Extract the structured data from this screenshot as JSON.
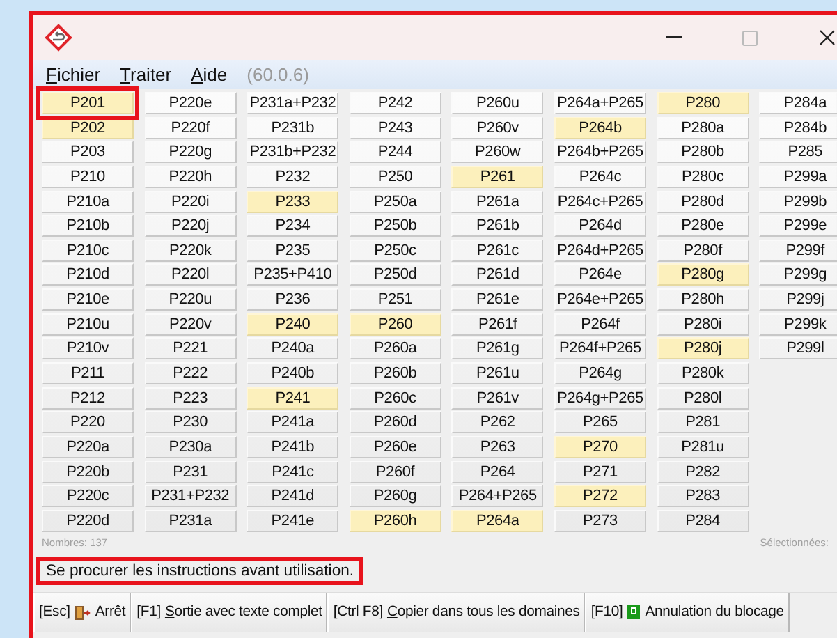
{
  "window": {
    "highlighted": true
  },
  "menu": [
    {
      "label": "Fichier",
      "mnemonic": true
    },
    {
      "label": "Traiter",
      "mnemonic": true
    },
    {
      "label": "Aide",
      "mnemonic": true
    }
  ],
  "version": "(60.0.6)",
  "codes": [
    [
      {
        "label": "P201",
        "selected": true,
        "highlighted": true
      },
      {
        "label": "P202",
        "selected": true,
        "highlighted": false
      },
      {
        "label": "P203",
        "selected": false,
        "highlighted": false
      },
      {
        "label": "P210",
        "selected": false,
        "highlighted": false
      },
      {
        "label": "P210a",
        "selected": false,
        "highlighted": false
      },
      {
        "label": "P210b",
        "selected": false,
        "highlighted": false
      },
      {
        "label": "P210c",
        "selected": false,
        "highlighted": false
      },
      {
        "label": "P210d",
        "selected": false,
        "highlighted": false
      },
      {
        "label": "P210e",
        "selected": false,
        "highlighted": false
      },
      {
        "label": "P210u",
        "selected": false,
        "highlighted": false
      },
      {
        "label": "P210v",
        "selected": false,
        "highlighted": false
      },
      {
        "label": "P211",
        "selected": false,
        "highlighted": false
      },
      {
        "label": "P212",
        "selected": false,
        "highlighted": false
      },
      {
        "label": "P220",
        "selected": false,
        "highlighted": false
      },
      {
        "label": "P220a",
        "selected": false,
        "highlighted": false
      },
      {
        "label": "P220b",
        "selected": false,
        "highlighted": false
      },
      {
        "label": "P220c",
        "selected": false,
        "highlighted": false
      },
      {
        "label": "P220d",
        "selected": false,
        "highlighted": false
      }
    ],
    [
      {
        "label": "P220e",
        "selected": false,
        "highlighted": false
      },
      {
        "label": "P220f",
        "selected": false,
        "highlighted": false
      },
      {
        "label": "P220g",
        "selected": false,
        "highlighted": false
      },
      {
        "label": "P220h",
        "selected": false,
        "highlighted": false
      },
      {
        "label": "P220i",
        "selected": false,
        "highlighted": false
      },
      {
        "label": "P220j",
        "selected": false,
        "highlighted": false
      },
      {
        "label": "P220k",
        "selected": false,
        "highlighted": false
      },
      {
        "label": "P220l",
        "selected": false,
        "highlighted": false
      },
      {
        "label": "P220u",
        "selected": false,
        "highlighted": false
      },
      {
        "label": "P220v",
        "selected": false,
        "highlighted": false
      },
      {
        "label": "P221",
        "selected": false,
        "highlighted": false
      },
      {
        "label": "P222",
        "selected": false,
        "highlighted": false
      },
      {
        "label": "P223",
        "selected": false,
        "highlighted": false
      },
      {
        "label": "P230",
        "selected": false,
        "highlighted": false
      },
      {
        "label": "P230a",
        "selected": false,
        "highlighted": false
      },
      {
        "label": "P231",
        "selected": false,
        "highlighted": false
      },
      {
        "label": "P231+P232",
        "selected": false,
        "highlighted": false
      },
      {
        "label": "P231a",
        "selected": false,
        "highlighted": false
      }
    ],
    [
      {
        "label": "P231a+P232",
        "selected": false,
        "highlighted": false
      },
      {
        "label": "P231b",
        "selected": false,
        "highlighted": false
      },
      {
        "label": "P231b+P232",
        "selected": false,
        "highlighted": false
      },
      {
        "label": "P232",
        "selected": false,
        "highlighted": false
      },
      {
        "label": "P233",
        "selected": true,
        "highlighted": false
      },
      {
        "label": "P234",
        "selected": false,
        "highlighted": false
      },
      {
        "label": "P235",
        "selected": false,
        "highlighted": false
      },
      {
        "label": "P235+P410",
        "selected": false,
        "highlighted": false
      },
      {
        "label": "P236",
        "selected": false,
        "highlighted": false
      },
      {
        "label": "P240",
        "selected": true,
        "highlighted": false
      },
      {
        "label": "P240a",
        "selected": false,
        "highlighted": false
      },
      {
        "label": "P240b",
        "selected": false,
        "highlighted": false
      },
      {
        "label": "P241",
        "selected": true,
        "highlighted": false
      },
      {
        "label": "P241a",
        "selected": false,
        "highlighted": false
      },
      {
        "label": "P241b",
        "selected": false,
        "highlighted": false
      },
      {
        "label": "P241c",
        "selected": false,
        "highlighted": false
      },
      {
        "label": "P241d",
        "selected": false,
        "highlighted": false
      },
      {
        "label": "P241e",
        "selected": false,
        "highlighted": false
      }
    ],
    [
      {
        "label": "P242",
        "selected": false,
        "highlighted": false
      },
      {
        "label": "P243",
        "selected": false,
        "highlighted": false
      },
      {
        "label": "P244",
        "selected": false,
        "highlighted": false
      },
      {
        "label": "P250",
        "selected": false,
        "highlighted": false
      },
      {
        "label": "P250a",
        "selected": false,
        "highlighted": false
      },
      {
        "label": "P250b",
        "selected": false,
        "highlighted": false
      },
      {
        "label": "P250c",
        "selected": false,
        "highlighted": false
      },
      {
        "label": "P250d",
        "selected": false,
        "highlighted": false
      },
      {
        "label": "P251",
        "selected": false,
        "highlighted": false
      },
      {
        "label": "P260",
        "selected": true,
        "highlighted": false
      },
      {
        "label": "P260a",
        "selected": false,
        "highlighted": false
      },
      {
        "label": "P260b",
        "selected": false,
        "highlighted": false
      },
      {
        "label": "P260c",
        "selected": false,
        "highlighted": false
      },
      {
        "label": "P260d",
        "selected": false,
        "highlighted": false
      },
      {
        "label": "P260e",
        "selected": false,
        "highlighted": false
      },
      {
        "label": "P260f",
        "selected": false,
        "highlighted": false
      },
      {
        "label": "P260g",
        "selected": false,
        "highlighted": false
      },
      {
        "label": "P260h",
        "selected": true,
        "highlighted": false
      }
    ],
    [
      {
        "label": "P260u",
        "selected": false,
        "highlighted": false
      },
      {
        "label": "P260v",
        "selected": false,
        "highlighted": false
      },
      {
        "label": "P260w",
        "selected": false,
        "highlighted": false
      },
      {
        "label": "P261",
        "selected": true,
        "highlighted": false
      },
      {
        "label": "P261a",
        "selected": false,
        "highlighted": false
      },
      {
        "label": "P261b",
        "selected": false,
        "highlighted": false
      },
      {
        "label": "P261c",
        "selected": false,
        "highlighted": false
      },
      {
        "label": "P261d",
        "selected": false,
        "highlighted": false
      },
      {
        "label": "P261e",
        "selected": false,
        "highlighted": false
      },
      {
        "label": "P261f",
        "selected": false,
        "highlighted": false
      },
      {
        "label": "P261g",
        "selected": false,
        "highlighted": false
      },
      {
        "label": "P261u",
        "selected": false,
        "highlighted": false
      },
      {
        "label": "P261v",
        "selected": false,
        "highlighted": false
      },
      {
        "label": "P262",
        "selected": false,
        "highlighted": false
      },
      {
        "label": "P263",
        "selected": false,
        "highlighted": false
      },
      {
        "label": "P264",
        "selected": false,
        "highlighted": false
      },
      {
        "label": "P264+P265",
        "selected": false,
        "highlighted": false
      },
      {
        "label": "P264a",
        "selected": true,
        "highlighted": false
      }
    ],
    [
      {
        "label": "P264a+P265",
        "selected": false,
        "highlighted": false
      },
      {
        "label": "P264b",
        "selected": true,
        "highlighted": false
      },
      {
        "label": "P264b+P265",
        "selected": false,
        "highlighted": false
      },
      {
        "label": "P264c",
        "selected": false,
        "highlighted": false
      },
      {
        "label": "P264c+P265",
        "selected": false,
        "highlighted": false
      },
      {
        "label": "P264d",
        "selected": false,
        "highlighted": false
      },
      {
        "label": "P264d+P265",
        "selected": false,
        "highlighted": false
      },
      {
        "label": "P264e",
        "selected": false,
        "highlighted": false
      },
      {
        "label": "P264e+P265",
        "selected": false,
        "highlighted": false
      },
      {
        "label": "P264f",
        "selected": false,
        "highlighted": false
      },
      {
        "label": "P264f+P265",
        "selected": false,
        "highlighted": false
      },
      {
        "label": "P264g",
        "selected": false,
        "highlighted": false
      },
      {
        "label": "P264g+P265",
        "selected": false,
        "highlighted": false
      },
      {
        "label": "P265",
        "selected": false,
        "highlighted": false
      },
      {
        "label": "P270",
        "selected": true,
        "highlighted": false
      },
      {
        "label": "P271",
        "selected": false,
        "highlighted": false
      },
      {
        "label": "P272",
        "selected": true,
        "highlighted": false
      },
      {
        "label": "P273",
        "selected": false,
        "highlighted": false
      }
    ],
    [
      {
        "label": "P280",
        "selected": true,
        "highlighted": false
      },
      {
        "label": "P280a",
        "selected": false,
        "highlighted": false
      },
      {
        "label": "P280b",
        "selected": false,
        "highlighted": false
      },
      {
        "label": "P280c",
        "selected": false,
        "highlighted": false
      },
      {
        "label": "P280d",
        "selected": false,
        "highlighted": false
      },
      {
        "label": "P280e",
        "selected": false,
        "highlighted": false
      },
      {
        "label": "P280f",
        "selected": false,
        "highlighted": false
      },
      {
        "label": "P280g",
        "selected": true,
        "highlighted": false
      },
      {
        "label": "P280h",
        "selected": false,
        "highlighted": false
      },
      {
        "label": "P280i",
        "selected": false,
        "highlighted": false
      },
      {
        "label": "P280j",
        "selected": true,
        "highlighted": false
      },
      {
        "label": "P280k",
        "selected": false,
        "highlighted": false
      },
      {
        "label": "P280l",
        "selected": false,
        "highlighted": false
      },
      {
        "label": "P281",
        "selected": false,
        "highlighted": false
      },
      {
        "label": "P281u",
        "selected": false,
        "highlighted": false
      },
      {
        "label": "P282",
        "selected": false,
        "highlighted": false
      },
      {
        "label": "P283",
        "selected": false,
        "highlighted": false
      },
      {
        "label": "P284",
        "selected": false,
        "highlighted": false
      }
    ],
    [
      {
        "label": "P284a",
        "selected": false,
        "highlighted": false
      },
      {
        "label": "P284b",
        "selected": false,
        "highlighted": false
      },
      {
        "label": "P285",
        "selected": false,
        "highlighted": false
      },
      {
        "label": "P299a",
        "selected": false,
        "highlighted": false
      },
      {
        "label": "P299b",
        "selected": false,
        "highlighted": false
      },
      {
        "label": "P299e",
        "selected": false,
        "highlighted": false
      },
      {
        "label": "P299f",
        "selected": false,
        "highlighted": false
      },
      {
        "label": "P299g",
        "selected": false,
        "highlighted": false
      },
      {
        "label": "P299j",
        "selected": false,
        "highlighted": false
      },
      {
        "label": "P299k",
        "selected": false,
        "highlighted": false
      },
      {
        "label": "P299l",
        "selected": false,
        "highlighted": false
      }
    ]
  ],
  "count_label": "Nombres: 137",
  "selected_label": "Sélectionnées:",
  "message": {
    "text": "Se procurer les instructions avant utilisation.",
    "highlighted": true
  },
  "buttons": [
    {
      "key": "[Esc]",
      "kind": "exit",
      "label": "Arrêt",
      "mnemonic": false
    },
    {
      "key": "[F1]",
      "label": "Sortie avec texte complet",
      "mnemonic": true
    },
    {
      "key": "[Ctrl F8]",
      "label": "Copier dans tous les domaines",
      "mnemonic": true
    },
    {
      "key": "[F10]",
      "kind": "unlock",
      "label": "Annulation du blocage",
      "mnemonic": false
    }
  ]
}
